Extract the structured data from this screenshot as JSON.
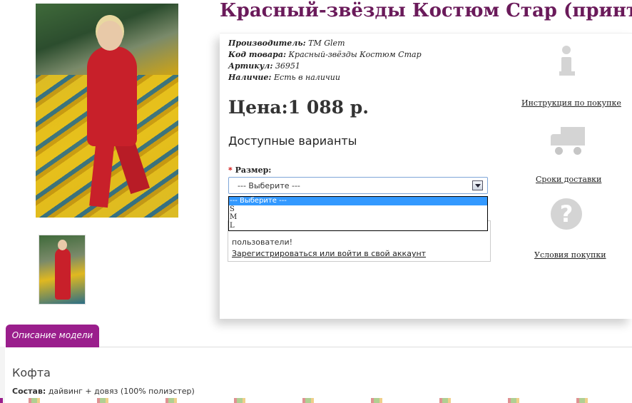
{
  "product": {
    "title": "Красный-звёзды Костюм Стар (принт)",
    "meta": [
      {
        "label": "Производитель:",
        "value": "ТМ Glem"
      },
      {
        "label": "Код товара:",
        "value": "Красный-звёзды Костюм Стар"
      },
      {
        "label": "Артикул:",
        "value": "36951"
      },
      {
        "label": "Наличие:",
        "value": "Есть в наличии"
      }
    ],
    "price": "Цена:1 088 р.",
    "variants_title": "Доступные варианты",
    "size": {
      "required_mark": "*",
      "label": "Размер:",
      "selected": "--- Выберите ---",
      "options": [
        "--- Выберите ---",
        "S",
        "M",
        "L"
      ]
    }
  },
  "login_notice": {
    "line1": "пользователи!",
    "link": "Зарегистрироваться или войти в свой аккаунт"
  },
  "sidebar": {
    "instruction_link": "Инструкция по покупке",
    "delivery_link": "Сроки доставки",
    "terms_link": "Условия покупки",
    "icons": [
      "info-icon",
      "truck-icon",
      "question-icon"
    ]
  },
  "tabs": {
    "description": "Описание модели"
  },
  "description": {
    "heading": "Кофта",
    "composition_label": "Состав:",
    "composition_value": "дайвинг + довяз (100% полиэстер)"
  },
  "colors": {
    "title": "#6a1a5a",
    "tab": "#9a1e8c",
    "dropdown_highlight": "#3399ff"
  }
}
